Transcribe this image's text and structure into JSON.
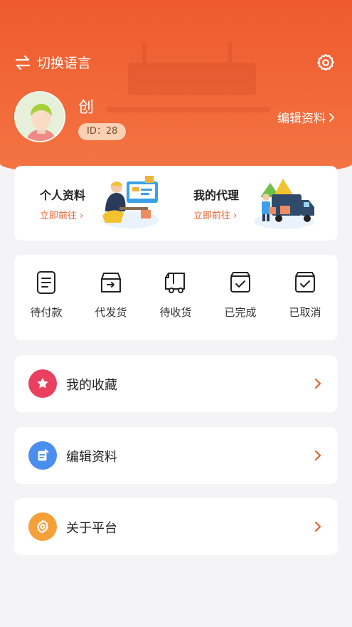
{
  "header": {
    "language_switch_label": "切换语言",
    "username": "创",
    "user_id": "ID：28",
    "edit_profile_label": "编辑资料"
  },
  "quick_links": [
    {
      "title": "个人资料",
      "action": "立即前往"
    },
    {
      "title": "我的代理",
      "action": "立即前往"
    }
  ],
  "orders": [
    {
      "label": "待付款",
      "icon": "pending-payment-icon"
    },
    {
      "label": "代发货",
      "icon": "to-ship-icon"
    },
    {
      "label": "待收货",
      "icon": "truck-icon"
    },
    {
      "label": "已完成",
      "icon": "completed-icon"
    },
    {
      "label": "已取消",
      "icon": "cancelled-icon"
    }
  ],
  "menu": [
    {
      "label": "我的收藏",
      "icon": "favorites-icon",
      "color": "#e8405e"
    },
    {
      "label": "编辑资料",
      "icon": "edit-icon",
      "color": "#4a8ef0"
    },
    {
      "label": "关于平台",
      "icon": "about-icon",
      "color": "#f5a03a"
    }
  ],
  "colors": {
    "brand": "#ee5a2e",
    "accent_text": "#e5622f",
    "background": "#f4f4f6"
  }
}
